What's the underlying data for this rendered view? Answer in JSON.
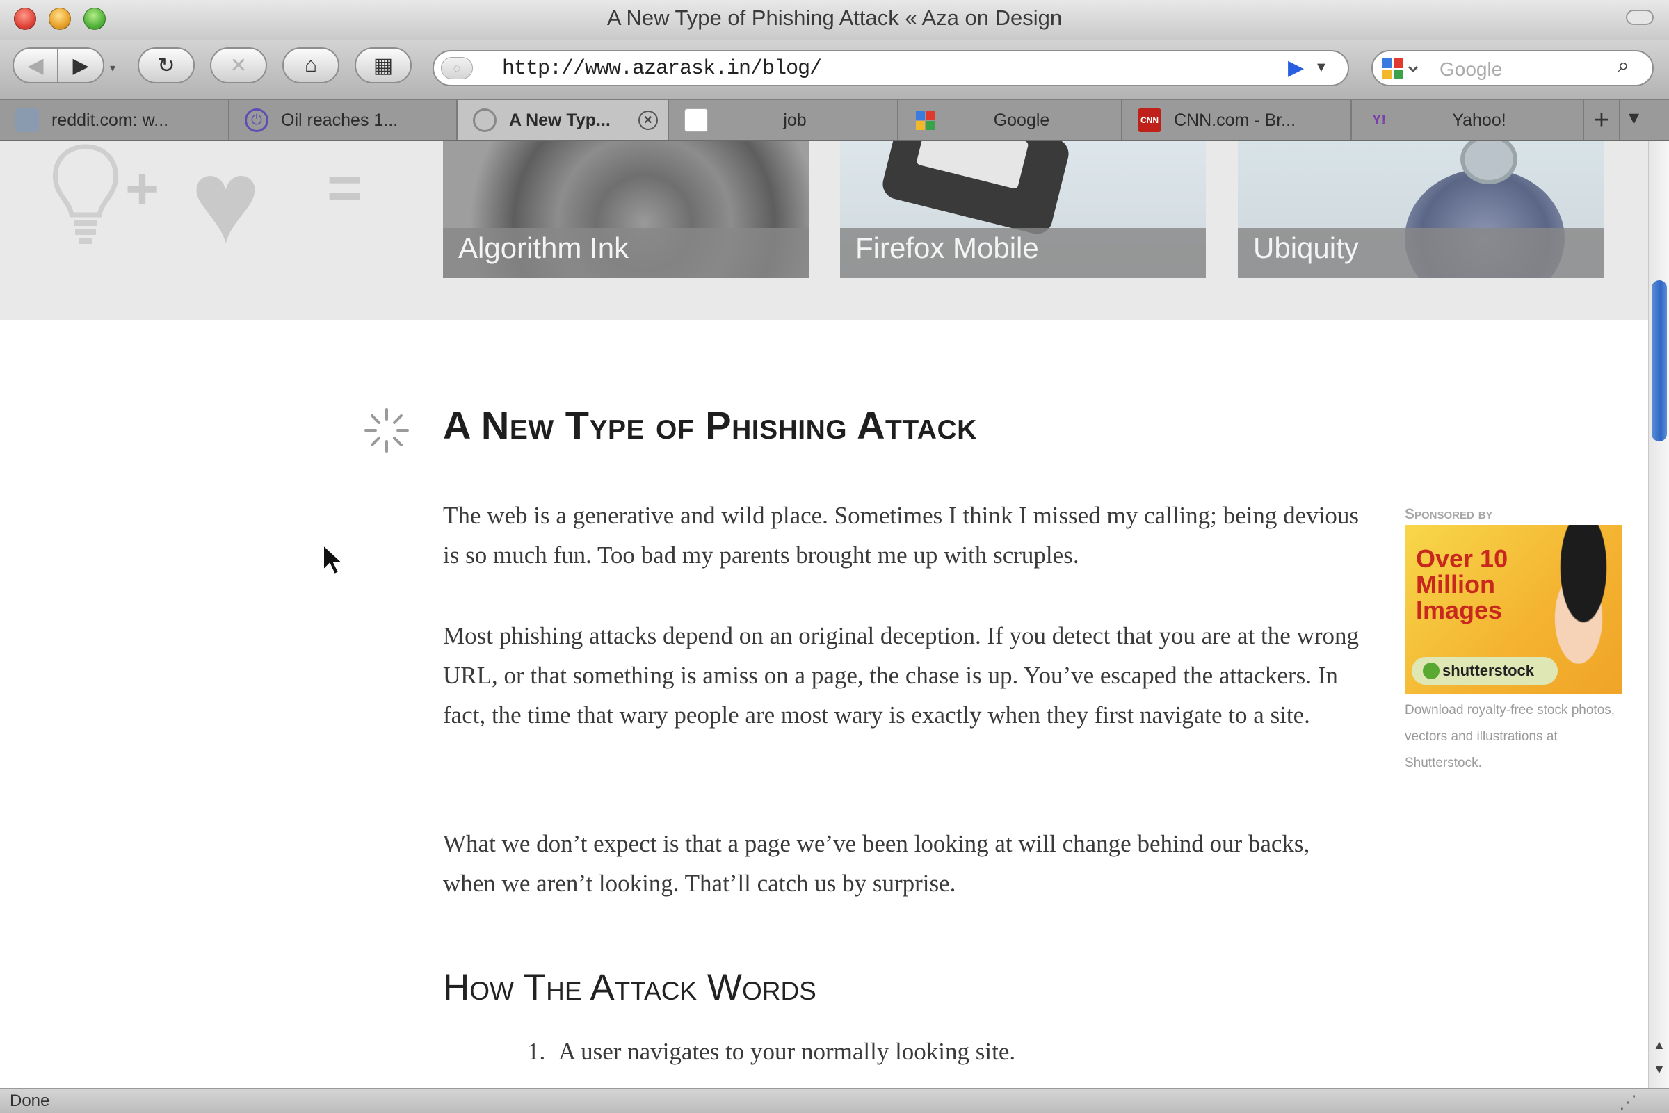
{
  "window": {
    "title": "A New Type of Phishing Attack « Aza on Design"
  },
  "toolbar": {
    "back": "◀",
    "forward": "▶",
    "reload": "↻",
    "stop": "✕",
    "home": "⌂",
    "tabs": "▦",
    "url": "http://www.azarask.in/blog/",
    "search_placeholder": "Google"
  },
  "tabs": [
    {
      "label": "reddit.com: w...",
      "icon": "reddit-icon",
      "color": "#8a9bb0"
    },
    {
      "label": "Oil reaches 1...",
      "icon": "power-icon",
      "color": "#5b4fb3"
    },
    {
      "label": "A New Typ...",
      "icon": "loading-icon",
      "color": "#777777",
      "active": true
    },
    {
      "label": "job",
      "icon": "document-icon",
      "color": "#ffffff"
    },
    {
      "label": "Google",
      "icon": "google-icon",
      "color": "#3f8f3f"
    },
    {
      "label": "CNN.com - Br...",
      "icon": "cnn-icon",
      "color": "#c0201a"
    },
    {
      "label": "Yahoo!",
      "icon": "yahoo-icon",
      "color": "#7a3fa8"
    }
  ],
  "features": [
    {
      "label": "Algorithm Ink"
    },
    {
      "label": "Firefox Mobile"
    },
    {
      "label": "Ubiquity"
    }
  ],
  "post": {
    "title": "A New Type of Phishing Attack",
    "paragraphs": [
      "The web is a generative and wild place. Sometimes I think I missed my calling; being devious is so much fun. Too bad my parents brought me up with scruples.",
      "Most phishing attacks depend on an original deception. If you detect that you are at the wrong URL, or that something is amiss on a page, the chase is up. You’ve escaped the attackers. In fact, the time that wary people are most wary is exactly when they first navigate to a site.",
      "What we don’t expect is that a page we’ve been looking at will change behind our backs, when we aren’t looking. That’ll catch us by surprise."
    ],
    "section_heading": "How The Attack Words",
    "list": [
      {
        "marker": "1.",
        "text": "A user navigates to your normally looking site."
      }
    ]
  },
  "sidebar": {
    "sponsor_label": "Sponsored by",
    "ad_headline": "Over 10 Million Images",
    "ad_brand": "shutterstock",
    "ad_caption": "Download royalty-free stock photos, vectors and illustrations at Shutterstock."
  },
  "status": {
    "text": "Done"
  },
  "colors": {
    "accent": "#2f66c5",
    "heading": "#1e1e1e",
    "body_text": "#3a3a3a"
  }
}
